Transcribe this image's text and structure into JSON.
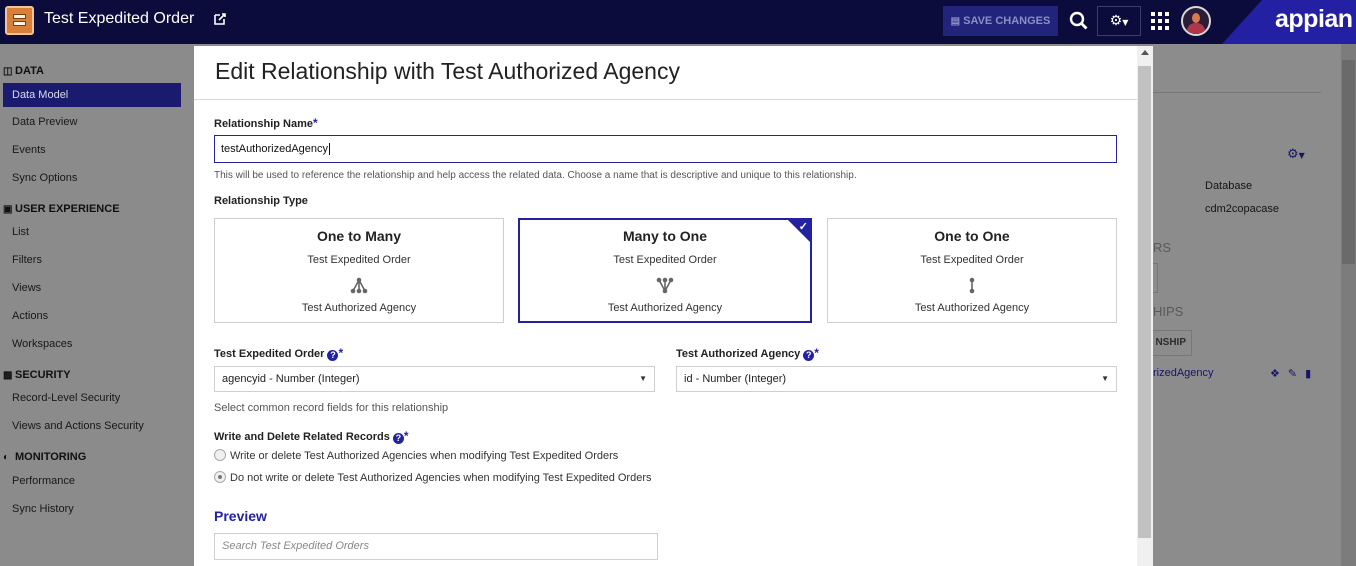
{
  "header": {
    "title": "Test Expedited Order",
    "save_label": "SAVE CHANGES",
    "brand": "appian"
  },
  "sidebar": {
    "sections": [
      {
        "title": "DATA",
        "icon": "database-icon",
        "items": [
          "Data Model",
          "Data Preview",
          "Events",
          "Sync Options"
        ]
      },
      {
        "title": "USER EXPERIENCE",
        "icon": "monitor-icon",
        "items": [
          "List",
          "Filters",
          "Views",
          "Actions",
          "Workspaces"
        ]
      },
      {
        "title": "SECURITY",
        "icon": "lock-icon",
        "items": [
          "Record-Level Security",
          "Views and Actions Security"
        ]
      },
      {
        "title": "MONITORING",
        "icon": "gauge-icon",
        "items": [
          "Performance",
          "Sync History"
        ]
      }
    ],
    "active_item": "Data Model"
  },
  "background": {
    "source_label": "Database",
    "source_value": "cdm2copacase",
    "fragment_1": "RS",
    "fragment_2": "HIPS",
    "button_fragment": "NSHIP",
    "link_fragment": "rizedAgency"
  },
  "modal": {
    "title": "Edit Relationship with Test Authorized Agency",
    "name_label": "Relationship Name",
    "name_value": "testAuthorizedAgency",
    "name_hint": "This will be used to reference the relationship and help access the related data. Choose a name that is descriptive and unique to this relationship.",
    "type_label": "Relationship Type",
    "types": [
      {
        "title": "One to Many",
        "source": "Test Expedited Order",
        "target": "Test Authorized Agency",
        "selected": false
      },
      {
        "title": "Many to One",
        "source": "Test Expedited Order",
        "target": "Test Authorized Agency",
        "selected": true
      },
      {
        "title": "One to One",
        "source": "Test Expedited Order",
        "target": "Test Authorized Agency",
        "selected": false
      }
    ],
    "source_field_label": "Test Expedited Order",
    "source_field_value": "agencyid - Number (Integer)",
    "target_field_label": "Test Authorized Agency",
    "target_field_value": "id - Number (Integer)",
    "fields_hint": "Select common record fields for this relationship",
    "write_label": "Write and Delete Related Records",
    "write_options": [
      {
        "label": "Write or delete Test Authorized Agencies when modifying Test Expedited Orders",
        "selected": false
      },
      {
        "label": "Do not write or delete Test Authorized Agencies when modifying Test Expedited Orders",
        "selected": true
      }
    ],
    "preview_label": "Preview",
    "search_placeholder": "Search Test Expedited Orders",
    "required_mark": "*"
  },
  "colors": {
    "accent": "#2322a0",
    "header_bg": "#0b0c3c",
    "active_nav": "#1a1b6e"
  }
}
